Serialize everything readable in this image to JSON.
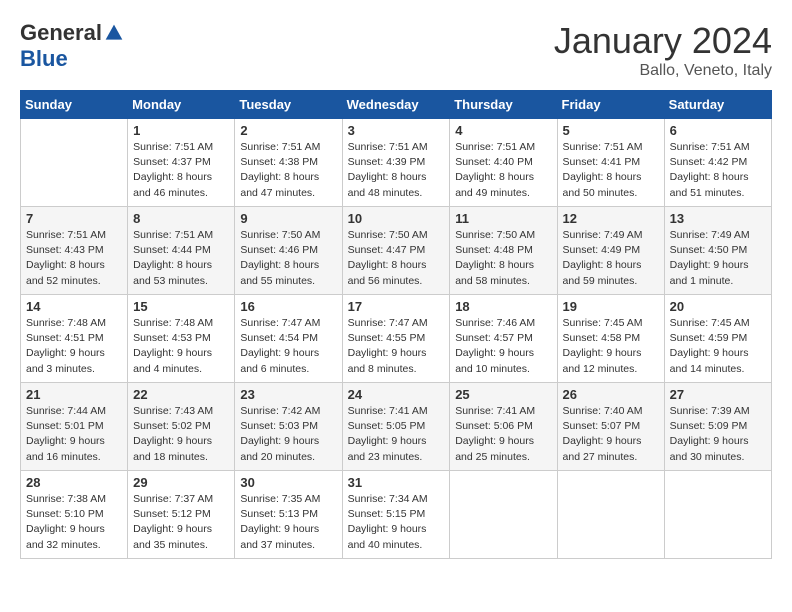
{
  "logo": {
    "general": "General",
    "blue": "Blue"
  },
  "title": {
    "month": "January 2024",
    "location": "Ballo, Veneto, Italy"
  },
  "weekdays": [
    "Sunday",
    "Monday",
    "Tuesday",
    "Wednesday",
    "Thursday",
    "Friday",
    "Saturday"
  ],
  "weeks": [
    [
      {
        "day": "",
        "info": ""
      },
      {
        "day": "1",
        "info": "Sunrise: 7:51 AM\nSunset: 4:37 PM\nDaylight: 8 hours\nand 46 minutes."
      },
      {
        "day": "2",
        "info": "Sunrise: 7:51 AM\nSunset: 4:38 PM\nDaylight: 8 hours\nand 47 minutes."
      },
      {
        "day": "3",
        "info": "Sunrise: 7:51 AM\nSunset: 4:39 PM\nDaylight: 8 hours\nand 48 minutes."
      },
      {
        "day": "4",
        "info": "Sunrise: 7:51 AM\nSunset: 4:40 PM\nDaylight: 8 hours\nand 49 minutes."
      },
      {
        "day": "5",
        "info": "Sunrise: 7:51 AM\nSunset: 4:41 PM\nDaylight: 8 hours\nand 50 minutes."
      },
      {
        "day": "6",
        "info": "Sunrise: 7:51 AM\nSunset: 4:42 PM\nDaylight: 8 hours\nand 51 minutes."
      }
    ],
    [
      {
        "day": "7",
        "info": "Sunrise: 7:51 AM\nSunset: 4:43 PM\nDaylight: 8 hours\nand 52 minutes."
      },
      {
        "day": "8",
        "info": "Sunrise: 7:51 AM\nSunset: 4:44 PM\nDaylight: 8 hours\nand 53 minutes."
      },
      {
        "day": "9",
        "info": "Sunrise: 7:50 AM\nSunset: 4:46 PM\nDaylight: 8 hours\nand 55 minutes."
      },
      {
        "day": "10",
        "info": "Sunrise: 7:50 AM\nSunset: 4:47 PM\nDaylight: 8 hours\nand 56 minutes."
      },
      {
        "day": "11",
        "info": "Sunrise: 7:50 AM\nSunset: 4:48 PM\nDaylight: 8 hours\nand 58 minutes."
      },
      {
        "day": "12",
        "info": "Sunrise: 7:49 AM\nSunset: 4:49 PM\nDaylight: 8 hours\nand 59 minutes."
      },
      {
        "day": "13",
        "info": "Sunrise: 7:49 AM\nSunset: 4:50 PM\nDaylight: 9 hours\nand 1 minute."
      }
    ],
    [
      {
        "day": "14",
        "info": "Sunrise: 7:48 AM\nSunset: 4:51 PM\nDaylight: 9 hours\nand 3 minutes."
      },
      {
        "day": "15",
        "info": "Sunrise: 7:48 AM\nSunset: 4:53 PM\nDaylight: 9 hours\nand 4 minutes."
      },
      {
        "day": "16",
        "info": "Sunrise: 7:47 AM\nSunset: 4:54 PM\nDaylight: 9 hours\nand 6 minutes."
      },
      {
        "day": "17",
        "info": "Sunrise: 7:47 AM\nSunset: 4:55 PM\nDaylight: 9 hours\nand 8 minutes."
      },
      {
        "day": "18",
        "info": "Sunrise: 7:46 AM\nSunset: 4:57 PM\nDaylight: 9 hours\nand 10 minutes."
      },
      {
        "day": "19",
        "info": "Sunrise: 7:45 AM\nSunset: 4:58 PM\nDaylight: 9 hours\nand 12 minutes."
      },
      {
        "day": "20",
        "info": "Sunrise: 7:45 AM\nSunset: 4:59 PM\nDaylight: 9 hours\nand 14 minutes."
      }
    ],
    [
      {
        "day": "21",
        "info": "Sunrise: 7:44 AM\nSunset: 5:01 PM\nDaylight: 9 hours\nand 16 minutes."
      },
      {
        "day": "22",
        "info": "Sunrise: 7:43 AM\nSunset: 5:02 PM\nDaylight: 9 hours\nand 18 minutes."
      },
      {
        "day": "23",
        "info": "Sunrise: 7:42 AM\nSunset: 5:03 PM\nDaylight: 9 hours\nand 20 minutes."
      },
      {
        "day": "24",
        "info": "Sunrise: 7:41 AM\nSunset: 5:05 PM\nDaylight: 9 hours\nand 23 minutes."
      },
      {
        "day": "25",
        "info": "Sunrise: 7:41 AM\nSunset: 5:06 PM\nDaylight: 9 hours\nand 25 minutes."
      },
      {
        "day": "26",
        "info": "Sunrise: 7:40 AM\nSunset: 5:07 PM\nDaylight: 9 hours\nand 27 minutes."
      },
      {
        "day": "27",
        "info": "Sunrise: 7:39 AM\nSunset: 5:09 PM\nDaylight: 9 hours\nand 30 minutes."
      }
    ],
    [
      {
        "day": "28",
        "info": "Sunrise: 7:38 AM\nSunset: 5:10 PM\nDaylight: 9 hours\nand 32 minutes."
      },
      {
        "day": "29",
        "info": "Sunrise: 7:37 AM\nSunset: 5:12 PM\nDaylight: 9 hours\nand 35 minutes."
      },
      {
        "day": "30",
        "info": "Sunrise: 7:35 AM\nSunset: 5:13 PM\nDaylight: 9 hours\nand 37 minutes."
      },
      {
        "day": "31",
        "info": "Sunrise: 7:34 AM\nSunset: 5:15 PM\nDaylight: 9 hours\nand 40 minutes."
      },
      {
        "day": "",
        "info": ""
      },
      {
        "day": "",
        "info": ""
      },
      {
        "day": "",
        "info": ""
      }
    ]
  ]
}
